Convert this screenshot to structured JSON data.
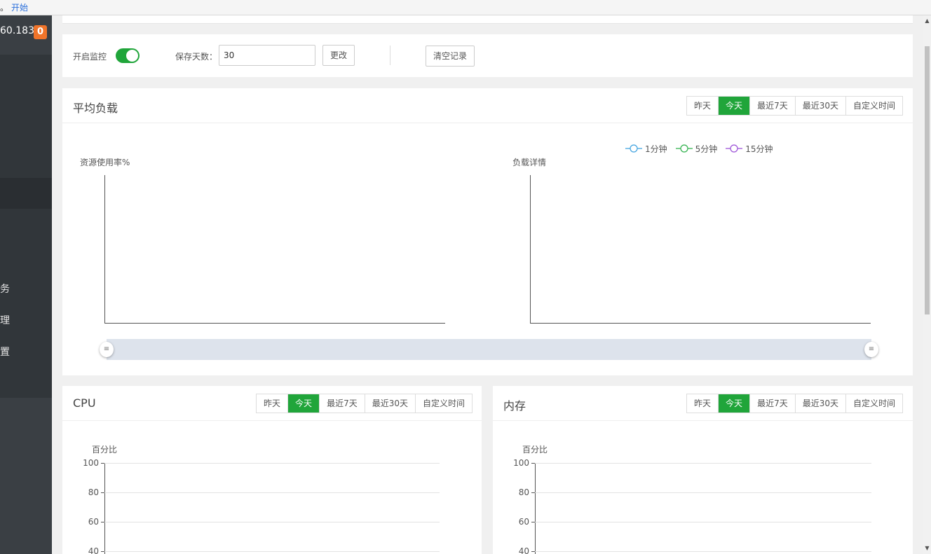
{
  "notice": {
    "prefix": "。",
    "link": "开始"
  },
  "sidebar": {
    "ip": "60.183",
    "badge": "0",
    "items": [
      {
        "label": "务"
      },
      {
        "label": "理"
      },
      {
        "label": "置"
      }
    ]
  },
  "controls": {
    "monitor_label": "开启监控",
    "monitor_enabled": true,
    "days_label": "保存天数：",
    "days_value": "30",
    "change_button": "更改",
    "clear_button": "清空记录"
  },
  "range_buttons": [
    "昨天",
    "今天",
    "最近7天",
    "最近30天",
    "自定义时间"
  ],
  "range_active": "今天",
  "load_panel": {
    "title": "平均负载",
    "left_chart_label": "资源使用率%",
    "right_chart_label": "负载详情",
    "legend": [
      {
        "name": "1分钟",
        "color": "#3fa2df"
      },
      {
        "name": "5分钟",
        "color": "#2eb04a"
      },
      {
        "name": "15分钟",
        "color": "#9a4fd6"
      }
    ],
    "slider_handle": "≡"
  },
  "cpu_panel": {
    "title": "CPU",
    "y_label": "百分比",
    "ticks": [
      "100",
      "80",
      "60",
      "40"
    ]
  },
  "mem_panel": {
    "title": "内存",
    "y_label": "百分比",
    "ticks": [
      "100",
      "80",
      "60",
      "40"
    ]
  }
}
